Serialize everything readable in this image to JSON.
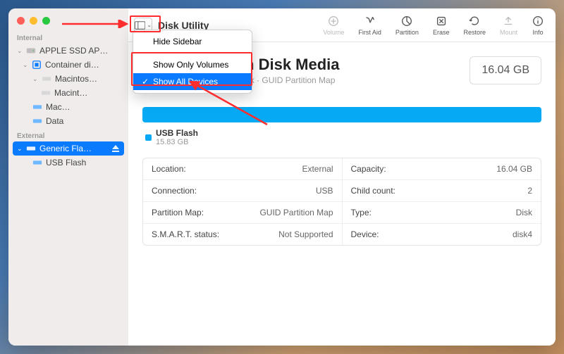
{
  "window_title": "Disk Utility",
  "toolbar": {
    "volume": "Volume",
    "first_aid": "First Aid",
    "partition": "Partition",
    "erase": "Erase",
    "restore": "Restore",
    "mount": "Mount",
    "info": "Info"
  },
  "sidebar": {
    "internal_label": "Internal",
    "external_label": "External",
    "items": {
      "apple_ssd": "APPLE SSD AP…",
      "container": "Container di…",
      "macintos": "Macintos…",
      "macint": "Macint…",
      "mac": "Mac…",
      "data": "Data",
      "generic": "Generic Fla…",
      "usb_flash": "USB Flash"
    }
  },
  "menu": {
    "hide_sidebar": "Hide Sidebar",
    "show_only_volumes": "Show Only Volumes",
    "show_all_devices": "Show All Devices"
  },
  "disk": {
    "title_suffix": "ric Flash Disk Media",
    "subtitle_suffix": "nal Physical Disk · GUID Partition Map",
    "size": "16.04 GB"
  },
  "legend": {
    "name": "USB Flash",
    "size": "15.83 GB"
  },
  "info": {
    "location_l": "Location:",
    "location_v": "External",
    "capacity_l": "Capacity:",
    "capacity_v": "16.04 GB",
    "connection_l": "Connection:",
    "connection_v": "USB",
    "child_l": "Child count:",
    "child_v": "2",
    "pmap_l": "Partition Map:",
    "pmap_v": "GUID Partition Map",
    "type_l": "Type:",
    "type_v": "Disk",
    "smart_l": "S.M.A.R.T. status:",
    "smart_v": "Not Supported",
    "device_l": "Device:",
    "device_v": "disk4"
  }
}
